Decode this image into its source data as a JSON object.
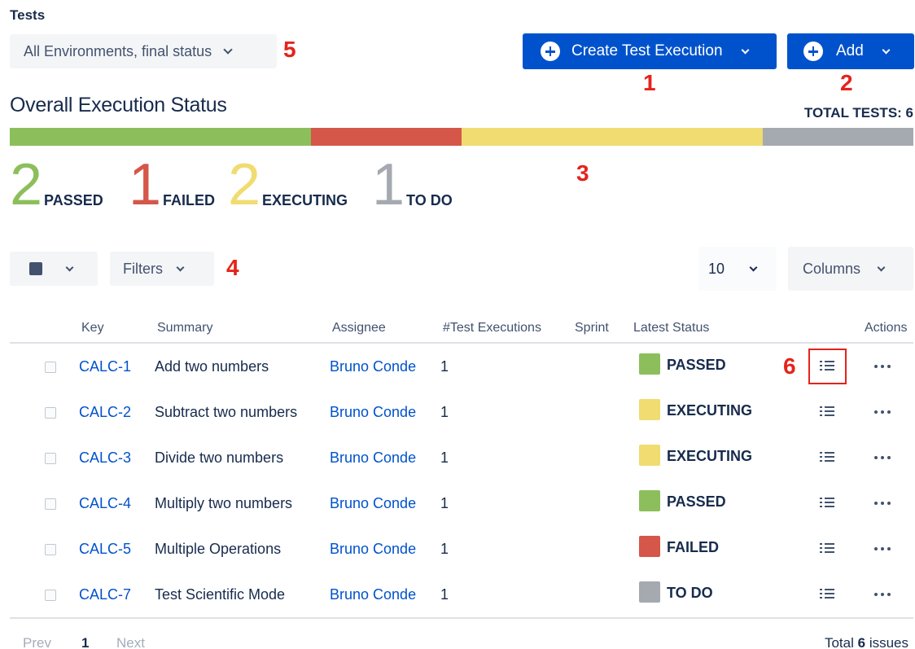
{
  "header": {
    "section_label": "Tests",
    "environment_select": "All Environments, final status",
    "create_button": "Create Test Execution",
    "add_button": "Add"
  },
  "annotations": [
    "1",
    "2",
    "3",
    "4",
    "5",
    "6"
  ],
  "overall": {
    "title": "Overall Execution Status",
    "total_tests": "TOTAL TESTS: 6",
    "segments": [
      {
        "status": "passed",
        "fraction": 0.3333,
        "color": "#8cbf5b"
      },
      {
        "status": "failed",
        "fraction": 0.1667,
        "color": "#d4574a"
      },
      {
        "status": "executing",
        "fraction": 0.3333,
        "color": "#f0dc70"
      },
      {
        "status": "todo",
        "fraction": 0.1667,
        "color": "#a5a9b0"
      }
    ],
    "counters": [
      {
        "count": "2",
        "label": "PASSED",
        "color": "#8cbf5b"
      },
      {
        "count": "1",
        "label": "FAILED",
        "color": "#d4574a"
      },
      {
        "count": "2",
        "label": "EXECUTING",
        "color": "#f0dc70"
      },
      {
        "count": "1",
        "label": "TO DO",
        "color": "#a5a9b0"
      }
    ]
  },
  "toolbar": {
    "filters": "Filters",
    "page_size": "10",
    "columns": "Columns"
  },
  "table": {
    "headers": {
      "key": "Key",
      "summary": "Summary",
      "assignee": "Assignee",
      "executions": "#Test Executions",
      "sprint": "Sprint",
      "latest_status": "Latest Status",
      "actions": "Actions"
    },
    "rows": [
      {
        "key": "CALC-1",
        "summary": "Add two numbers",
        "assignee": "Bruno Conde",
        "executions": "1",
        "status": "PASSED",
        "status_color": "#8cbf5b"
      },
      {
        "key": "CALC-2",
        "summary": "Subtract two numbers",
        "assignee": "Bruno Conde",
        "executions": "1",
        "status": "EXECUTING",
        "status_color": "#f0dc70"
      },
      {
        "key": "CALC-3",
        "summary": "Divide two numbers",
        "assignee": "Bruno Conde",
        "executions": "1",
        "status": "EXECUTING",
        "status_color": "#f0dc70"
      },
      {
        "key": "CALC-4",
        "summary": "Multiply two numbers",
        "assignee": "Bruno Conde",
        "executions": "1",
        "status": "PASSED",
        "status_color": "#8cbf5b"
      },
      {
        "key": "CALC-5",
        "summary": "Multiple Operations",
        "assignee": "Bruno Conde",
        "executions": "1",
        "status": "FAILED",
        "status_color": "#d4574a"
      },
      {
        "key": "CALC-7",
        "summary": "Test Scientific Mode",
        "assignee": "Bruno Conde",
        "executions": "1",
        "status": "TO DO",
        "status_color": "#a5a9b0"
      }
    ]
  },
  "pagination": {
    "prev": "Prev",
    "current": "1",
    "next": "Next",
    "total_prefix": "Total",
    "total_count": "6",
    "total_suffix": "issues"
  }
}
